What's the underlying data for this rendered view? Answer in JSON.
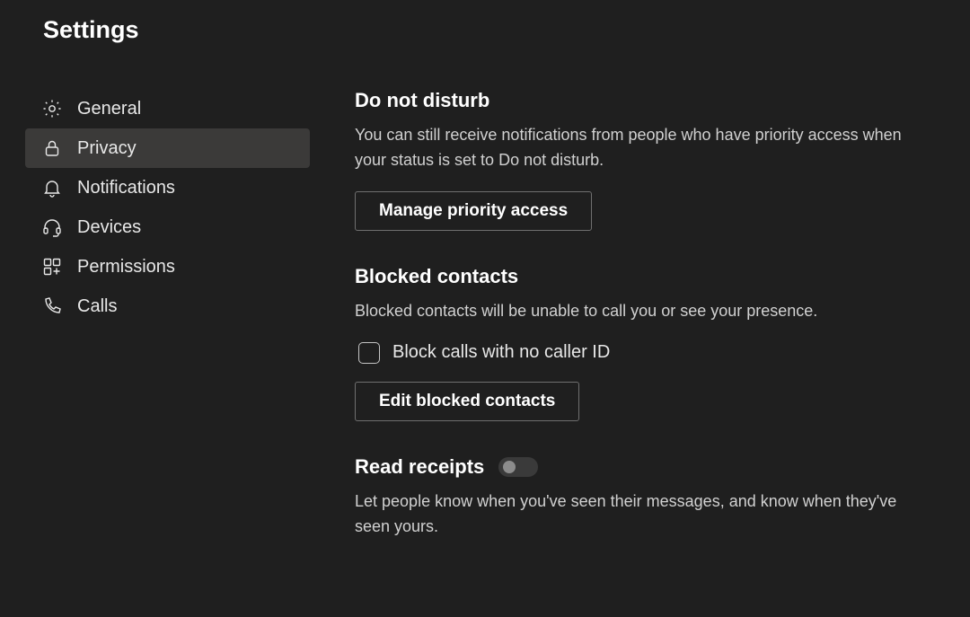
{
  "title": "Settings",
  "sidebar": {
    "items": [
      {
        "label": "General"
      },
      {
        "label": "Privacy"
      },
      {
        "label": "Notifications"
      },
      {
        "label": "Devices"
      },
      {
        "label": "Permissions"
      },
      {
        "label": "Calls"
      }
    ]
  },
  "dnd": {
    "title": "Do not disturb",
    "desc": "You can still receive notifications from people who have priority access when your status is set to Do not disturb.",
    "button": "Manage priority access"
  },
  "blocked": {
    "title": "Blocked contacts",
    "desc": "Blocked contacts will be unable to call you or see your presence.",
    "checkbox_label": "Block calls with no caller ID",
    "button": "Edit blocked contacts"
  },
  "read_receipts": {
    "title": "Read receipts",
    "desc": "Let people know when you've seen their messages, and know when they've seen yours."
  }
}
